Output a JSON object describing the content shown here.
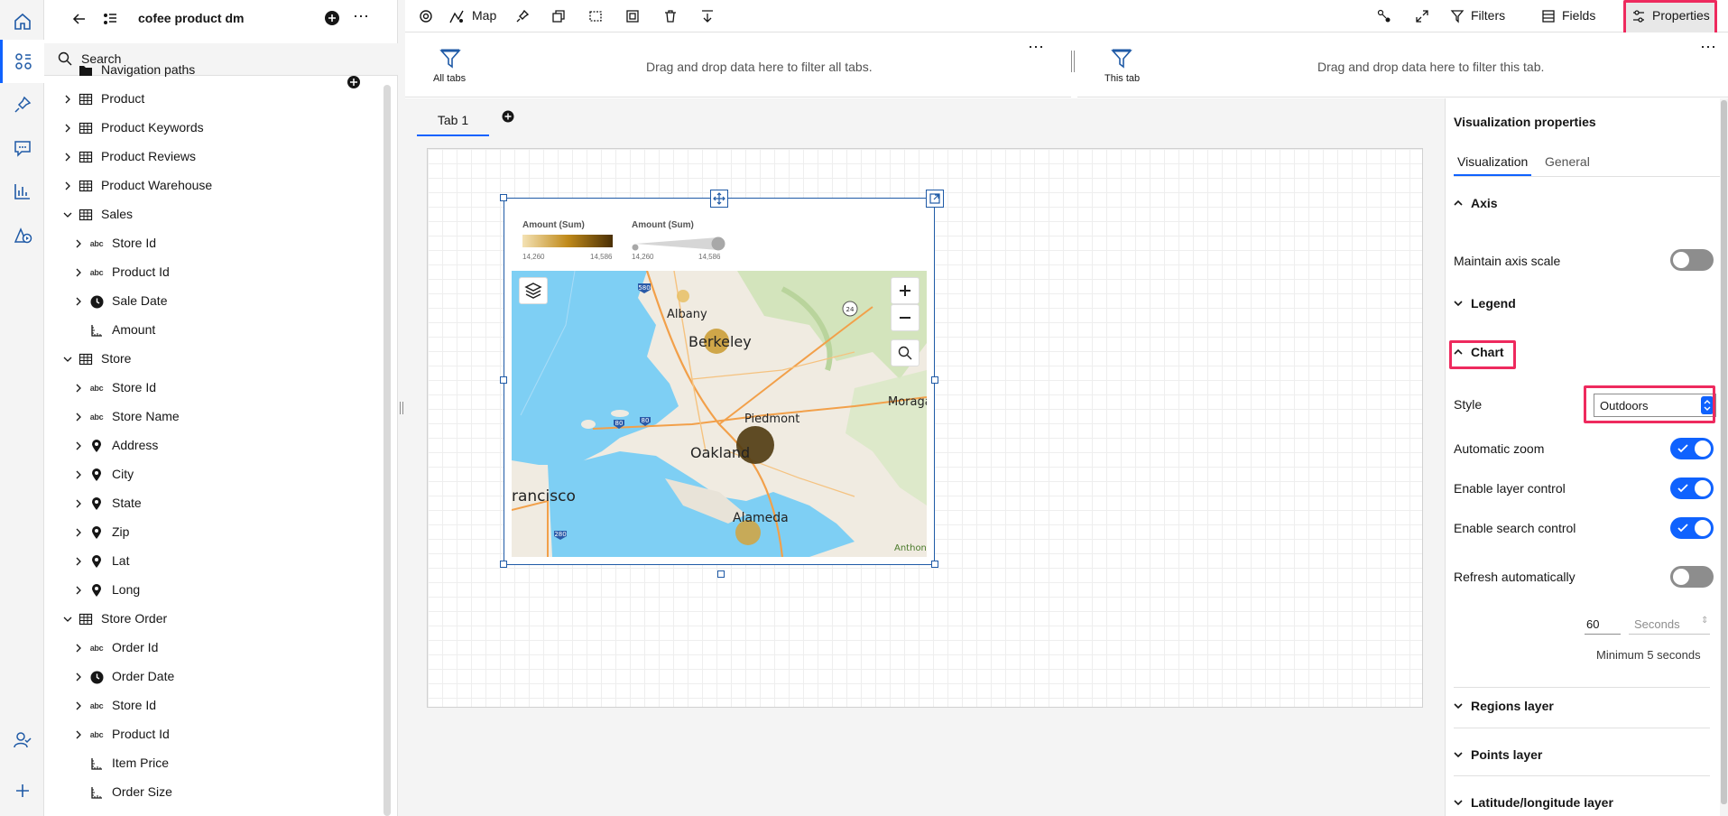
{
  "colors": {
    "accent": "#0f62fe",
    "highlight": "#ee2a5e",
    "map_water": "#7ecff4",
    "map_land": "#f0ebe1"
  },
  "tree": {
    "title": "cofee product dm",
    "search_placeholder": "Search",
    "rows": [
      {
        "label": "Navigation paths",
        "icon": "folder-icon",
        "level": 0,
        "expandable": false
      },
      {
        "label": "Product",
        "icon": "table-icon",
        "level": 0,
        "expandable": true,
        "expanded": false
      },
      {
        "label": "Product Keywords",
        "icon": "table-icon",
        "level": 0,
        "expandable": true,
        "expanded": false
      },
      {
        "label": "Product Reviews",
        "icon": "table-icon",
        "level": 0,
        "expandable": true,
        "expanded": false
      },
      {
        "label": "Product Warehouse",
        "icon": "table-icon",
        "level": 0,
        "expandable": true,
        "expanded": false
      },
      {
        "label": "Sales",
        "icon": "table-icon",
        "level": 0,
        "expandable": true,
        "expanded": true
      },
      {
        "label": "Store Id",
        "icon": "abc",
        "level": 1,
        "expandable": true,
        "expanded": false
      },
      {
        "label": "Product Id",
        "icon": "abc",
        "level": 1,
        "expandable": true,
        "expanded": false
      },
      {
        "label": "Sale Date",
        "icon": "clock-icon",
        "level": 1,
        "expandable": true,
        "expanded": false
      },
      {
        "label": "Amount",
        "icon": "measure-icon",
        "level": 1,
        "expandable": false
      },
      {
        "label": "Store",
        "icon": "table-icon",
        "level": 0,
        "expandable": true,
        "expanded": true
      },
      {
        "label": "Store Id",
        "icon": "abc",
        "level": 1,
        "expandable": true,
        "expanded": false
      },
      {
        "label": "Store Name",
        "icon": "abc",
        "level": 1,
        "expandable": true,
        "expanded": false
      },
      {
        "label": "Address",
        "icon": "location-icon",
        "level": 1,
        "expandable": true,
        "expanded": false
      },
      {
        "label": "City",
        "icon": "location-icon",
        "level": 1,
        "expandable": true,
        "expanded": false
      },
      {
        "label": "State",
        "icon": "location-icon",
        "level": 1,
        "expandable": true,
        "expanded": false
      },
      {
        "label": "Zip",
        "icon": "location-icon",
        "level": 1,
        "expandable": true,
        "expanded": false
      },
      {
        "label": "Lat",
        "icon": "location-icon",
        "level": 1,
        "expandable": true,
        "expanded": false
      },
      {
        "label": "Long",
        "icon": "location-icon",
        "level": 1,
        "expandable": true,
        "expanded": false
      },
      {
        "label": "Store Order",
        "icon": "table-icon",
        "level": 0,
        "expandable": true,
        "expanded": true
      },
      {
        "label": "Order Id",
        "icon": "abc",
        "level": 1,
        "expandable": true,
        "expanded": false
      },
      {
        "label": "Order Date",
        "icon": "clock-icon",
        "level": 1,
        "expandable": true,
        "expanded": false
      },
      {
        "label": "Store Id",
        "icon": "abc",
        "level": 1,
        "expandable": true,
        "expanded": false
      },
      {
        "label": "Product Id",
        "icon": "abc",
        "level": 1,
        "expandable": true,
        "expanded": false
      },
      {
        "label": "Item Price",
        "icon": "measure-icon",
        "level": 1,
        "expandable": false
      },
      {
        "label": "Order Size",
        "icon": "measure-icon",
        "level": 1,
        "expandable": false
      }
    ]
  },
  "toolbar": {
    "viz_label": "Map",
    "filters_label": "Filters",
    "fields_label": "Fields",
    "properties_label": "Properties"
  },
  "filters": {
    "all_tabs_label": "All tabs",
    "all_tabs_hint": "Drag and drop data here to filter all tabs.",
    "this_tab_label": "This tab",
    "this_tab_hint": "Drag and drop data here to filter this tab."
  },
  "tabs": {
    "active": "Tab 1"
  },
  "widget": {
    "color_legend": {
      "title": "Amount (Sum)",
      "min": "14,260",
      "max": "14,586"
    },
    "size_legend": {
      "title": "Amount (Sum)",
      "min": "14,260",
      "max": "14,586"
    },
    "map_labels": [
      "Albany",
      "Berkeley",
      "Piedmont",
      "Oakland",
      "Alameda",
      "rancisco",
      "Moraga",
      "Anthon"
    ],
    "highway_shields": [
      "580",
      "24",
      "80",
      "80",
      "280"
    ]
  },
  "properties": {
    "title": "Visualization properties",
    "tabs": [
      "Visualization",
      "General"
    ],
    "active_tab": "Visualization",
    "sections": {
      "axis": "Axis",
      "legend": "Legend",
      "chart": "Chart",
      "regions": "Regions layer",
      "points": "Points layer",
      "latlong": "Latitude/longitude layer"
    },
    "maintain_axis_scale": {
      "label": "Maintain axis scale",
      "on": false
    },
    "style": {
      "label": "Style",
      "value": "Outdoors"
    },
    "automatic_zoom": {
      "label": "Automatic zoom",
      "on": true
    },
    "layer_control": {
      "label": "Enable layer control",
      "on": true
    },
    "search_control": {
      "label": "Enable search control",
      "on": true
    },
    "refresh": {
      "label": "Refresh automatically",
      "on": false
    },
    "refresh_interval": {
      "value": "60",
      "unit": "Seconds"
    },
    "minimum_note": "Minimum 5 seconds"
  }
}
